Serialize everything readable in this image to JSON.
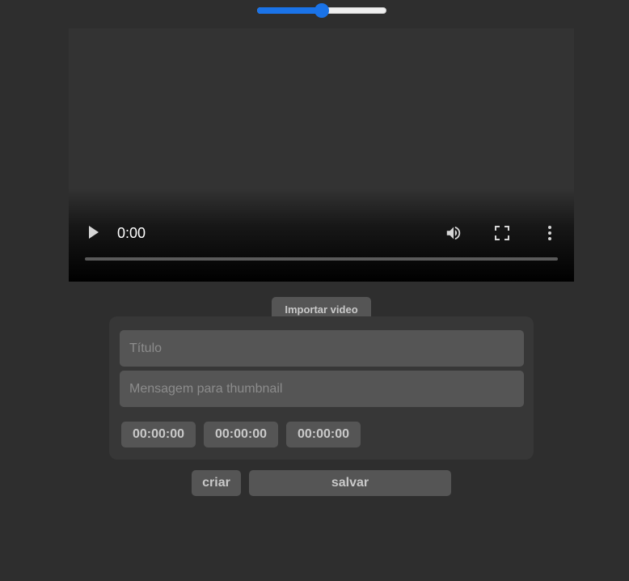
{
  "zoom_slider": {
    "value_fraction": 0.5,
    "color": "#1a73e8"
  },
  "video": {
    "time": "0:00",
    "controls": {
      "play": "play-icon",
      "volume": "volume-icon",
      "fullscreen": "fullscreen-icon",
      "more": "more-options-icon"
    }
  },
  "import_button": "Importar video",
  "form": {
    "title_placeholder": "Título",
    "thumbnail_placeholder": "Mensagem para thumbnail",
    "timestamps": [
      "00:00:00",
      "00:00:00",
      "00:00:00"
    ]
  },
  "actions": {
    "create": "criar",
    "save": "salvar"
  }
}
